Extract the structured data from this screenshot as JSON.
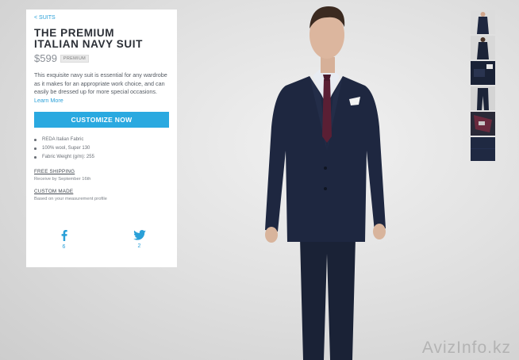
{
  "product": {
    "breadcrumb": "< SUITS",
    "title_line1": "THE PREMIUM",
    "title_line2": "ITALIAN NAVY SUIT",
    "price": "$599",
    "badge": "PREMIUM",
    "description": "This exquisite navy suit is essential for any wardrobe as it makes for an appropriate work choice, and can easily be dressed up for more special occasions.",
    "learn_more": "Learn More",
    "cta_label": "CUSTOMIZE NOW",
    "features": [
      "REDA Italian Fabric",
      "100% wool, Super 130",
      "Fabric Weight (g/m): 255"
    ],
    "shipping_title": "FREE SHIPPING",
    "shipping_text": "Receive by September 16th",
    "custom_title": "CUSTOM MADE",
    "custom_text": "Based on your measurement profile"
  },
  "social": {
    "facebook_count": "6",
    "twitter_count": "2"
  },
  "thumbnails": [
    "full-suit-front",
    "full-suit-back",
    "jacket-detail",
    "trousers",
    "lining-detail",
    "fabric-swatch"
  ],
  "watermark": "AvizInfo.kz",
  "colors": {
    "accent": "#2aa9e0",
    "suit_navy": "#1c2438",
    "tie": "#5a1f34"
  }
}
